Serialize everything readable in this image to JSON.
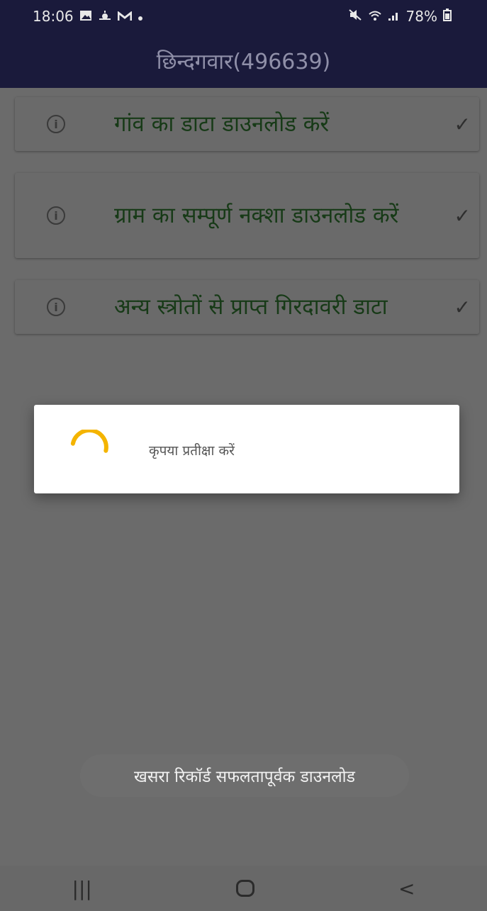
{
  "status_bar": {
    "time": "18:06",
    "left_icons": [
      "gallery-icon",
      "weather-icon",
      "gmail-icon",
      "notification-dot-icon"
    ],
    "battery": "78%",
    "right_icons": [
      "mute-icon",
      "wifi-icon",
      "signal-icon",
      "battery-icon"
    ]
  },
  "header": {
    "title": "छिन्दगवार(496639)"
  },
  "items": [
    {
      "label": "गांव का डाटा डाउनलोड करें",
      "check": "✓"
    },
    {
      "label": "ग्राम का सम्पूर्ण नक्शा डाउनलोड करें",
      "check": "✓"
    },
    {
      "label": "अन्य स्त्रोतों से प्राप्त गिरदावरी डाटा",
      "check": "✓"
    }
  ],
  "info_glyph": "i",
  "dialog": {
    "message": "कृपया प्रतीक्षा करें"
  },
  "toast": {
    "message": "खसरा रिकॉर्ड सफलतापूर्वक डाउनलोड"
  },
  "nav": {
    "recents_glyph": "|||",
    "back_glyph": "<"
  },
  "colors": {
    "header_bg": "#1a1a3b",
    "spinner": "#f4b400",
    "item_text": "#173a17"
  }
}
